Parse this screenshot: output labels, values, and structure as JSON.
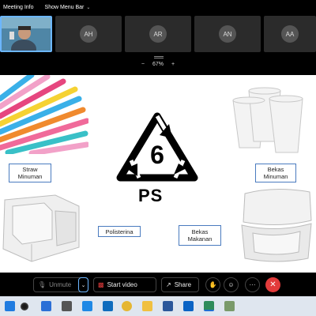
{
  "topbar": {
    "meeting_info": "Meeting Info",
    "show_menu_bar": "Show Menu Bar"
  },
  "gallery": {
    "participants": [
      "AH",
      "AR",
      "AN",
      "AA"
    ]
  },
  "zoom": {
    "minus": "−",
    "level": "67%",
    "plus": "+"
  },
  "slide": {
    "recycle_number": "6",
    "recycle_code": "PS",
    "labels": {
      "straw": "Straw\nMinuman",
      "cups": "Bekas\nMinuman",
      "polisterina": "Polisterina",
      "container": "Bekas\nMakanan"
    }
  },
  "controls": {
    "unmute": "Unmute",
    "start_video": "Start video",
    "share": "Share"
  },
  "colors": {
    "accent": "#6cb6ff",
    "end_call": "#e23b3b",
    "label_border": "#4a7bbf"
  }
}
